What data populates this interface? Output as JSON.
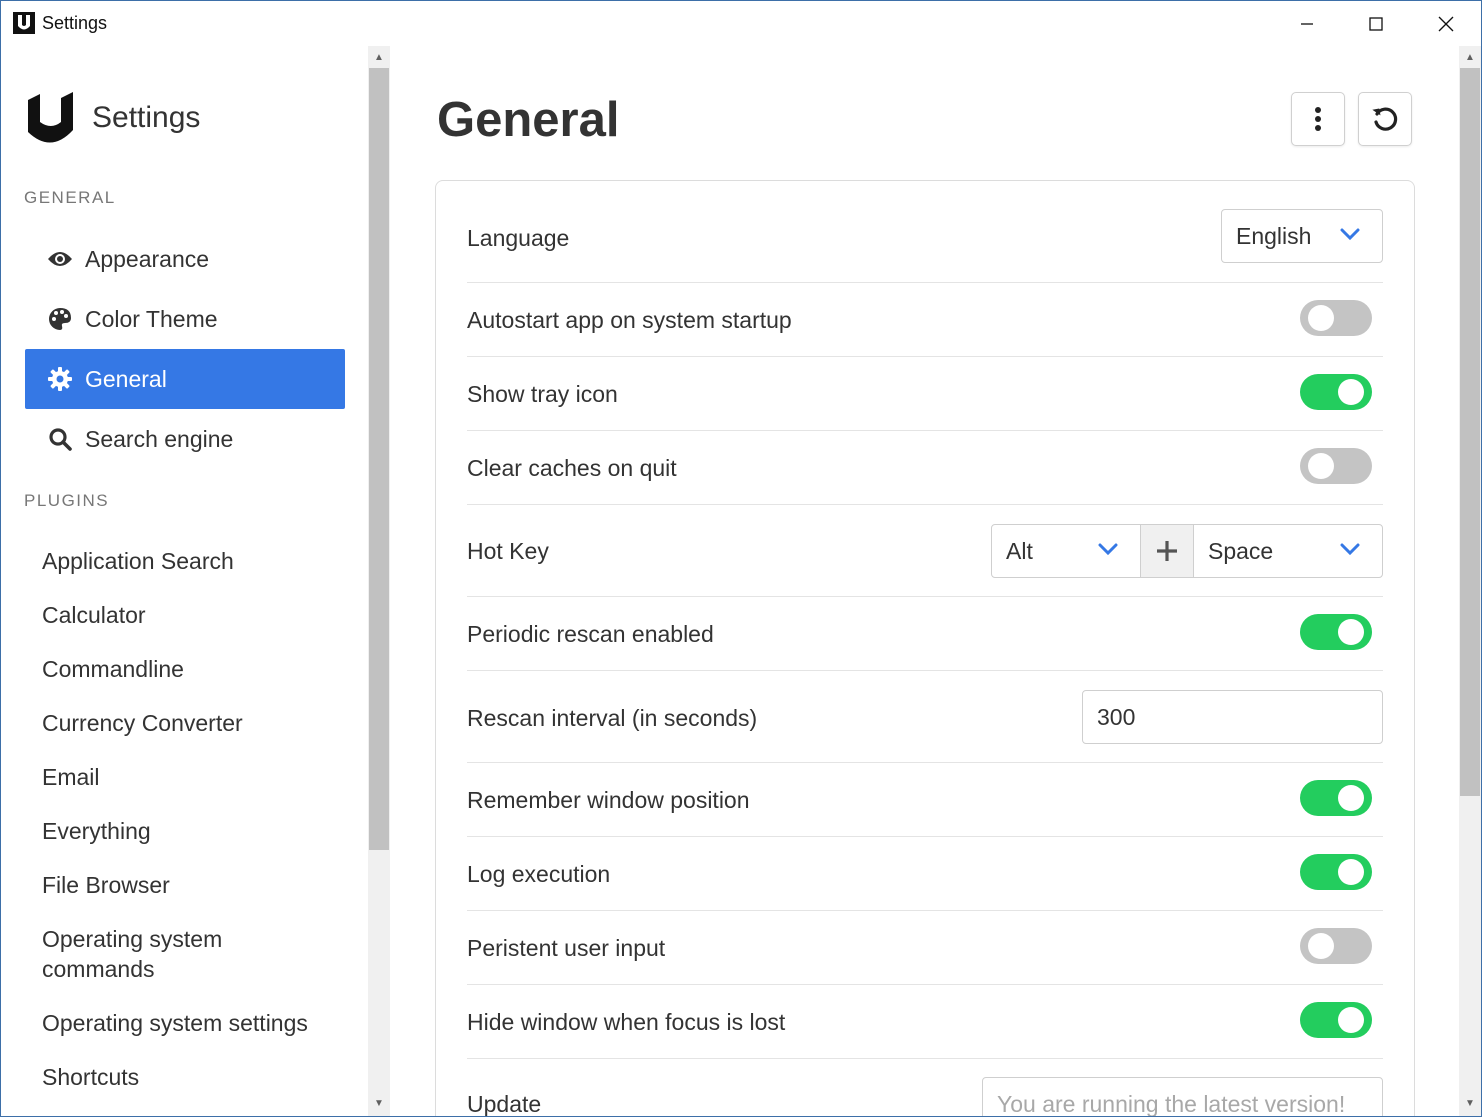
{
  "window": {
    "title": "Settings",
    "controls": {
      "minimize": "minimize",
      "maximize": "maximize",
      "close": "close"
    }
  },
  "sidebar": {
    "brand_title": "Settings",
    "general_section": "GENERAL",
    "nav_items": [
      {
        "label": "Appearance",
        "icon": "eye-icon",
        "active": false
      },
      {
        "label": "Color Theme",
        "icon": "palette-icon",
        "active": false
      },
      {
        "label": "General",
        "icon": "gear-icon",
        "active": true
      },
      {
        "label": "Search engine",
        "icon": "search-icon",
        "active": false
      }
    ],
    "plugins_section": "PLUGINS",
    "plugins": [
      "Application Search",
      "Calculator",
      "Commandline",
      "Currency Converter",
      "Email",
      "Everything",
      "File Browser",
      "Operating system commands",
      "Operating system settings",
      "Shortcuts"
    ]
  },
  "main": {
    "title": "General",
    "more_button": "more-vertical-icon",
    "reset_button": "reset-icon",
    "settings": {
      "language": {
        "label": "Language",
        "value": "English"
      },
      "autostart": {
        "label": "Autostart app on system startup",
        "enabled": false
      },
      "tray_icon": {
        "label": "Show tray icon",
        "enabled": true
      },
      "clear_caches": {
        "label": "Clear caches on quit",
        "enabled": false
      },
      "hotkey": {
        "label": "Hot Key",
        "modifier": "Alt",
        "plus": "+",
        "key": "Space"
      },
      "periodic_rescan": {
        "label": "Periodic rescan enabled",
        "enabled": true
      },
      "rescan_interval": {
        "label": "Rescan interval (in seconds)",
        "value": "300"
      },
      "remember_position": {
        "label": "Remember window position",
        "enabled": true
      },
      "log_execution": {
        "label": "Log execution",
        "enabled": true
      },
      "persistent_input": {
        "label": "Peristent user input",
        "enabled": false
      },
      "hide_on_blur": {
        "label": "Hide window when focus is lost",
        "enabled": true
      },
      "update": {
        "label": "Update",
        "placeholder": "You are running the latest version!"
      }
    }
  },
  "colors": {
    "accent": "#3578e5",
    "toggle_on": "#23cd5e",
    "toggle_off": "#c4c4c4",
    "chevron": "#3578e5"
  }
}
